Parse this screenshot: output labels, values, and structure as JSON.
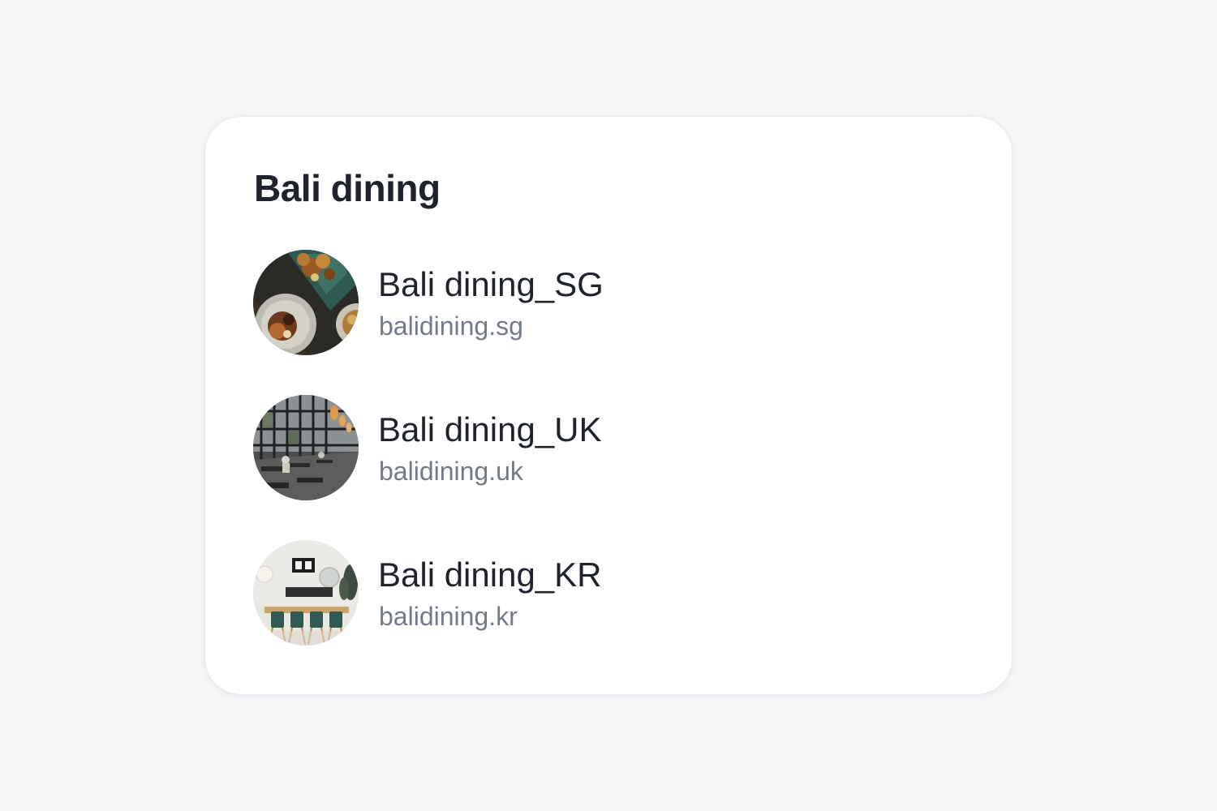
{
  "card": {
    "title": "Bali dining"
  },
  "items": [
    {
      "name": "Bali dining_SG",
      "url": "balidining.sg",
      "avatar_icon": "food-plates-photo-icon"
    },
    {
      "name": "Bali dining_UK",
      "url": "balidining.uk",
      "avatar_icon": "restaurant-interior-photo-icon"
    },
    {
      "name": "Bali dining_KR",
      "url": "balidining.kr",
      "avatar_icon": "dining-room-photo-icon"
    }
  ],
  "colors": {
    "background": "#f5f6f8",
    "card": "#ffffff",
    "text_primary": "#1f232b",
    "text_secondary": "#737b88"
  }
}
